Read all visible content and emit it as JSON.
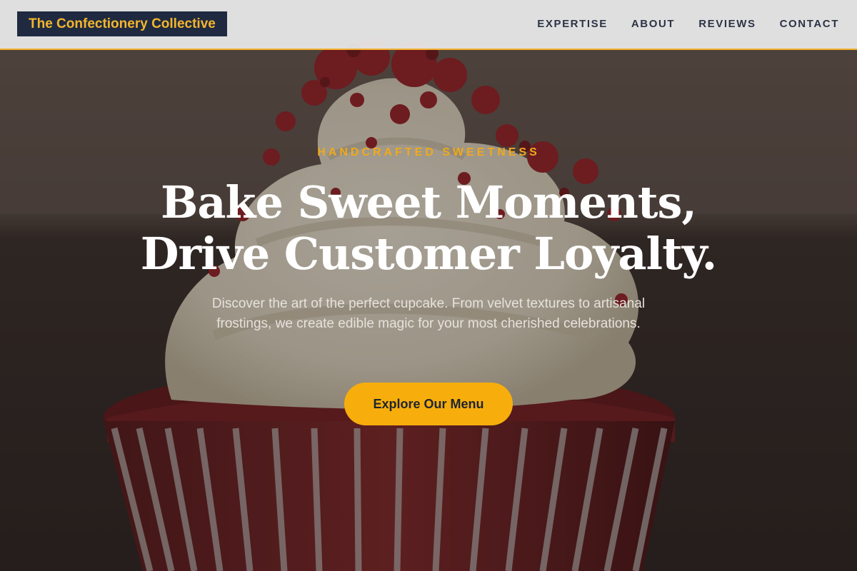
{
  "brand": {
    "name": "The Confectionery Collective"
  },
  "nav": {
    "items": [
      {
        "label": "EXPERTISE"
      },
      {
        "label": "ABOUT"
      },
      {
        "label": "REVIEWS"
      },
      {
        "label": "CONTACT"
      }
    ]
  },
  "hero": {
    "eyebrow": "HANDCRAFTED SWEETNESS",
    "headline_line1": "Bake Sweet Moments,",
    "headline_line2": "Drive Customer Loyalty.",
    "subtext": "Discover the art of the perfect cupcake. From velvet textures to artisanal frostings, we create edible magic for your most cherished celebrations.",
    "cta_label": "Explore Our Menu",
    "background_image": "red-velvet-cupcake-photo"
  },
  "colors": {
    "accent": "#f7ae0c",
    "brand_bg": "#1f2a40",
    "brand_text": "#f5b52e",
    "nav_text": "#2b3446",
    "nav_border": "#f2b12b"
  }
}
